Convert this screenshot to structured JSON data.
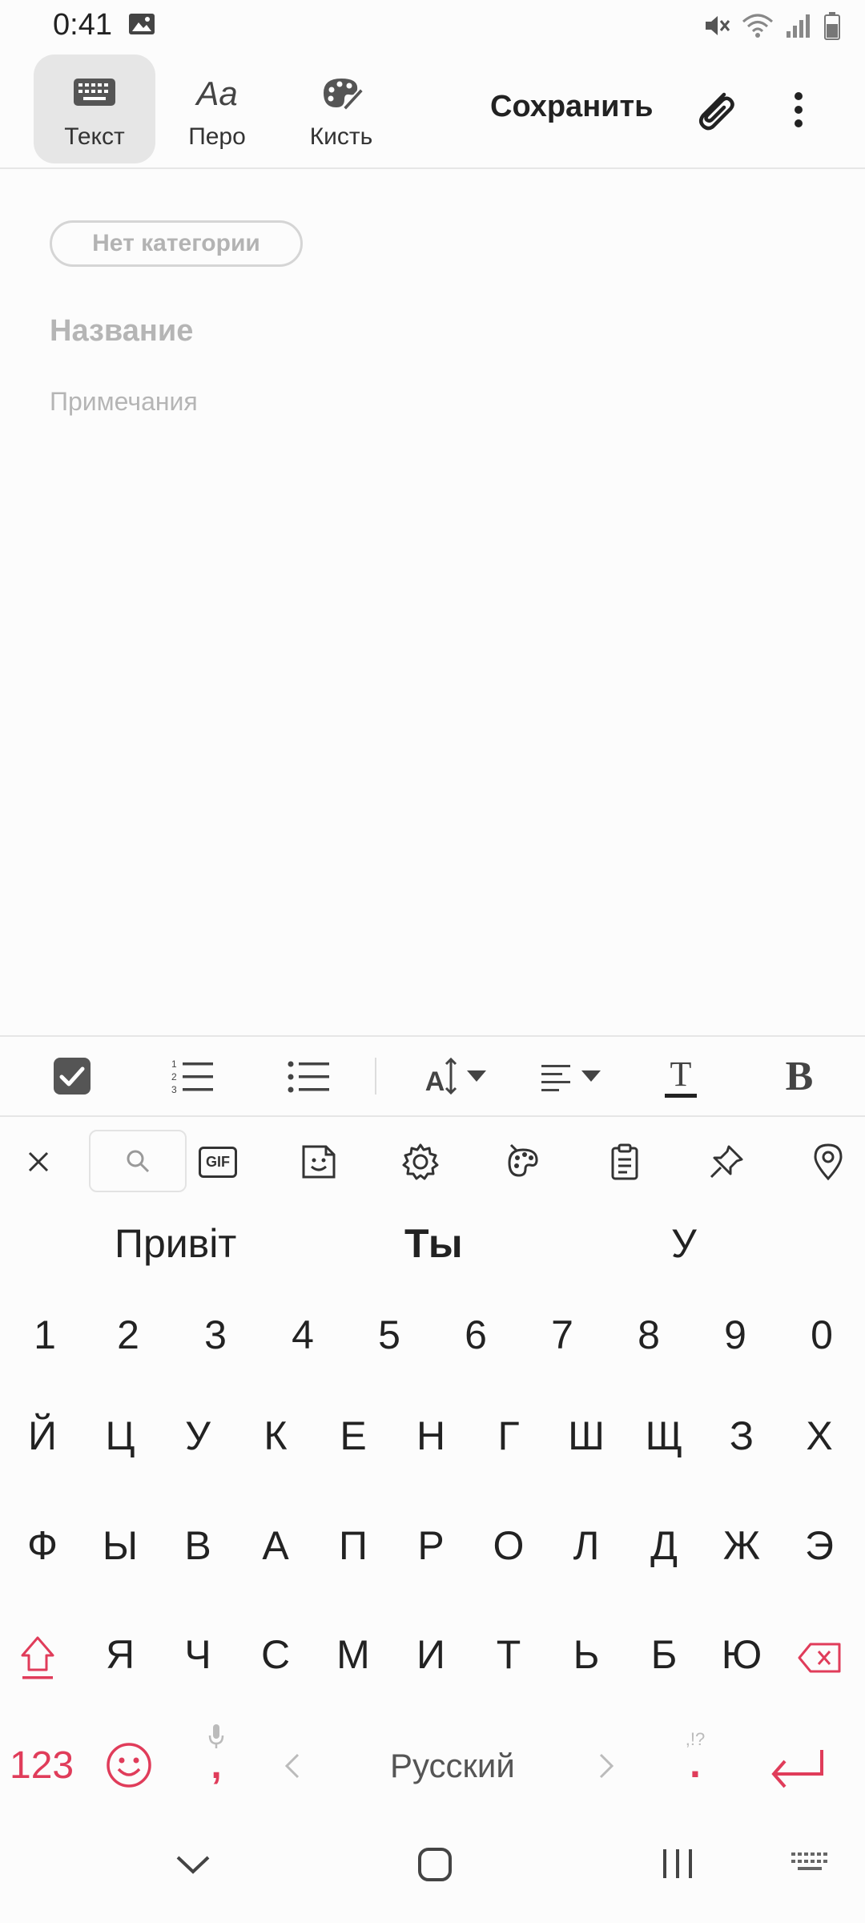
{
  "status": {
    "time": "0:41"
  },
  "toolbar": {
    "tools": [
      {
        "label": "Текст",
        "icon": "keyboard-icon",
        "active": true
      },
      {
        "label": "Перо",
        "icon": "pen-text-icon",
        "active": false
      },
      {
        "label": "Кисть",
        "icon": "brush-palette-icon",
        "active": false
      }
    ],
    "save_label": "Сохранить",
    "pen_glyph": "Aa"
  },
  "note": {
    "category": "Нет категории",
    "title_placeholder": "Название",
    "notes_placeholder": "Примечания"
  },
  "format": {
    "font_size_glyph": "A",
    "text_color_glyph": "T",
    "bold_glyph": "B"
  },
  "keyboard": {
    "gif_label": "GIF",
    "suggestions": [
      "Привіт",
      "Ты",
      "У"
    ],
    "numbers": [
      "1",
      "2",
      "3",
      "4",
      "5",
      "6",
      "7",
      "8",
      "9",
      "0"
    ],
    "row1": [
      "Й",
      "Ц",
      "У",
      "К",
      "Е",
      "Н",
      "Г",
      "Ш",
      "Щ",
      "З",
      "Х"
    ],
    "row2": [
      "Ф",
      "Ы",
      "В",
      "А",
      "П",
      "Р",
      "О",
      "Л",
      "Д",
      "Ж",
      "Э"
    ],
    "row3": [
      "Я",
      "Ч",
      "С",
      "М",
      "И",
      "Т",
      "Ь",
      "Б",
      "Ю"
    ],
    "num_key": "123",
    "comma_key": ",",
    "period_key": ".",
    "punct_hint": ",!?",
    "language": "Русский",
    "accent_color": "#e03c5a"
  }
}
